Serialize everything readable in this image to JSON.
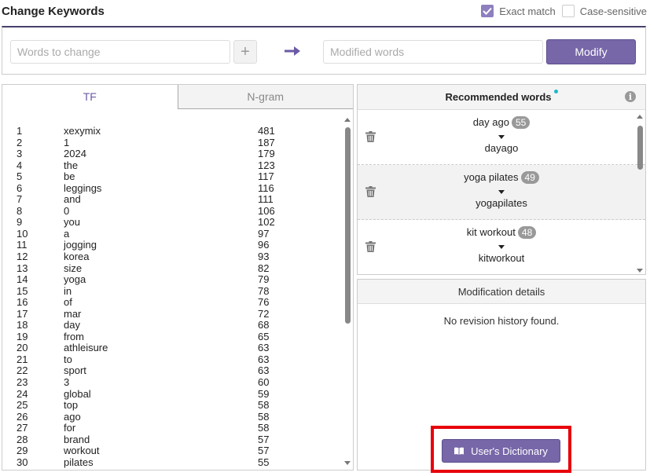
{
  "header": {
    "title": "Change Keywords",
    "exact_match_label": "Exact match",
    "exact_match_checked": true,
    "case_sensitive_label": "Case-sensitive",
    "case_sensitive_checked": false
  },
  "change_bar": {
    "words_placeholder": "Words to change",
    "add_label": "+",
    "modified_placeholder": "Modified words",
    "modify_label": "Modify"
  },
  "tabs": [
    {
      "label": "TF",
      "active": true
    },
    {
      "label": "N-gram",
      "active": false
    }
  ],
  "tf_list": [
    {
      "rank": "1",
      "word": "xexymix",
      "count": "481"
    },
    {
      "rank": "2",
      "word": "1",
      "count": "187"
    },
    {
      "rank": "3",
      "word": "2024",
      "count": "179"
    },
    {
      "rank": "4",
      "word": "the",
      "count": "123"
    },
    {
      "rank": "5",
      "word": "be",
      "count": "117"
    },
    {
      "rank": "6",
      "word": "leggings",
      "count": "116"
    },
    {
      "rank": "7",
      "word": "and",
      "count": "111"
    },
    {
      "rank": "8",
      "word": "0",
      "count": "106"
    },
    {
      "rank": "9",
      "word": "you",
      "count": "102"
    },
    {
      "rank": "10",
      "word": "a",
      "count": "97"
    },
    {
      "rank": "11",
      "word": "jogging",
      "count": "96"
    },
    {
      "rank": "12",
      "word": "korea",
      "count": "93"
    },
    {
      "rank": "13",
      "word": "size",
      "count": "82"
    },
    {
      "rank": "14",
      "word": "yoga",
      "count": "79"
    },
    {
      "rank": "15",
      "word": "in",
      "count": "78"
    },
    {
      "rank": "16",
      "word": "of",
      "count": "76"
    },
    {
      "rank": "17",
      "word": "mar",
      "count": "72"
    },
    {
      "rank": "18",
      "word": "day",
      "count": "68"
    },
    {
      "rank": "19",
      "word": "from",
      "count": "65"
    },
    {
      "rank": "20",
      "word": "athleisure",
      "count": "63"
    },
    {
      "rank": "21",
      "word": "to",
      "count": "63"
    },
    {
      "rank": "22",
      "word": "sport",
      "count": "63"
    },
    {
      "rank": "23",
      "word": "3",
      "count": "60"
    },
    {
      "rank": "24",
      "word": "global",
      "count": "59"
    },
    {
      "rank": "25",
      "word": "top",
      "count": "58"
    },
    {
      "rank": "26",
      "word": "ago",
      "count": "58"
    },
    {
      "rank": "27",
      "word": "for",
      "count": "58"
    },
    {
      "rank": "28",
      "word": "brand",
      "count": "57"
    },
    {
      "rank": "29",
      "word": "workout",
      "count": "57"
    },
    {
      "rank": "30",
      "word": "pilates",
      "count": "55"
    }
  ],
  "recommended": {
    "title": "Recommended words",
    "info_icon": "i",
    "items": [
      {
        "original": "day ago",
        "count": "55",
        "suggestion": "dayago"
      },
      {
        "original": "yoga pilates",
        "count": "49",
        "suggestion": "yogapilates"
      },
      {
        "original": "kit workout",
        "count": "48",
        "suggestion": "kitworkout"
      }
    ]
  },
  "modification": {
    "title": "Modification details",
    "empty_text": "No revision history found.",
    "dictionary_button": "User's Dictionary"
  },
  "colors": {
    "accent": "#7766a8",
    "highlight_border": "#e8000b",
    "dot": "#1fb7c8"
  }
}
